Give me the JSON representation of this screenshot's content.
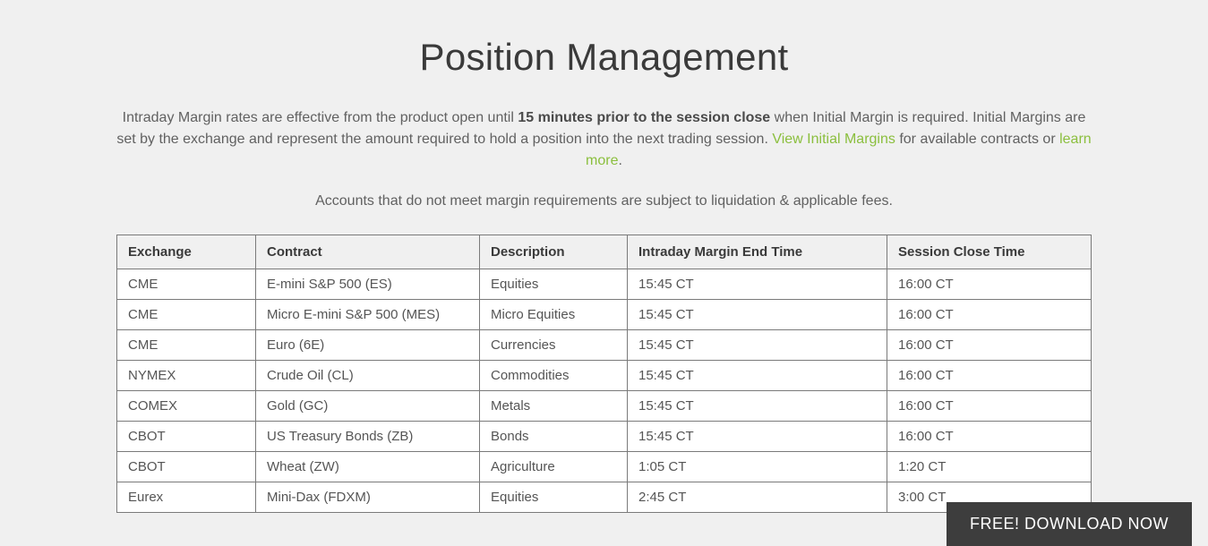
{
  "title": "Position Management",
  "intro": {
    "part1": "Intraday Margin rates are effective from the product open until ",
    "bold": "15 minutes prior to the session close",
    "part2": " when Initial Margin is required. Initial Margins are set by the exchange and represent the amount required to hold a position into the next trading session. ",
    "link1": "View Initial Margins",
    "part3": " for available contracts or ",
    "link2": "learn more",
    "part4": "."
  },
  "note": "Accounts that do not meet margin requirements are subject to liquidation & applicable fees.",
  "table": {
    "headers": {
      "exchange": "Exchange",
      "contract": "Contract",
      "description": "Description",
      "intraday": "Intraday Margin End Time",
      "session": "Session Close Time"
    },
    "rows": [
      {
        "exchange": "CME",
        "contract": "E-mini S&P 500 (ES)",
        "description": "Equities",
        "intraday": "15:45 CT",
        "session": "16:00 CT"
      },
      {
        "exchange": "CME",
        "contract": "Micro E-mini S&P 500 (MES)",
        "description": "Micro Equities",
        "intraday": "15:45 CT",
        "session": "16:00 CT"
      },
      {
        "exchange": "CME",
        "contract": "Euro (6E)",
        "description": "Currencies",
        "intraday": "15:45 CT",
        "session": "16:00 CT"
      },
      {
        "exchange": "NYMEX",
        "contract": "Crude Oil (CL)",
        "description": "Commodities",
        "intraday": "15:45 CT",
        "session": "16:00 CT"
      },
      {
        "exchange": "COMEX",
        "contract": "Gold (GC)",
        "description": "Metals",
        "intraday": "15:45 CT",
        "session": "16:00 CT"
      },
      {
        "exchange": "CBOT",
        "contract": "US Treasury Bonds (ZB)",
        "description": "Bonds",
        "intraday": "15:45 CT",
        "session": "16:00 CT"
      },
      {
        "exchange": "CBOT",
        "contract": "Wheat (ZW)",
        "description": "Agriculture",
        "intraday": "1:05 CT",
        "session": "1:20 CT"
      },
      {
        "exchange": "Eurex",
        "contract": "Mini-Dax (FDXM)",
        "description": "Equities",
        "intraday": "2:45 CT",
        "session": "3:00 CT"
      }
    ]
  },
  "cta": "FREE! DOWNLOAD NOW"
}
